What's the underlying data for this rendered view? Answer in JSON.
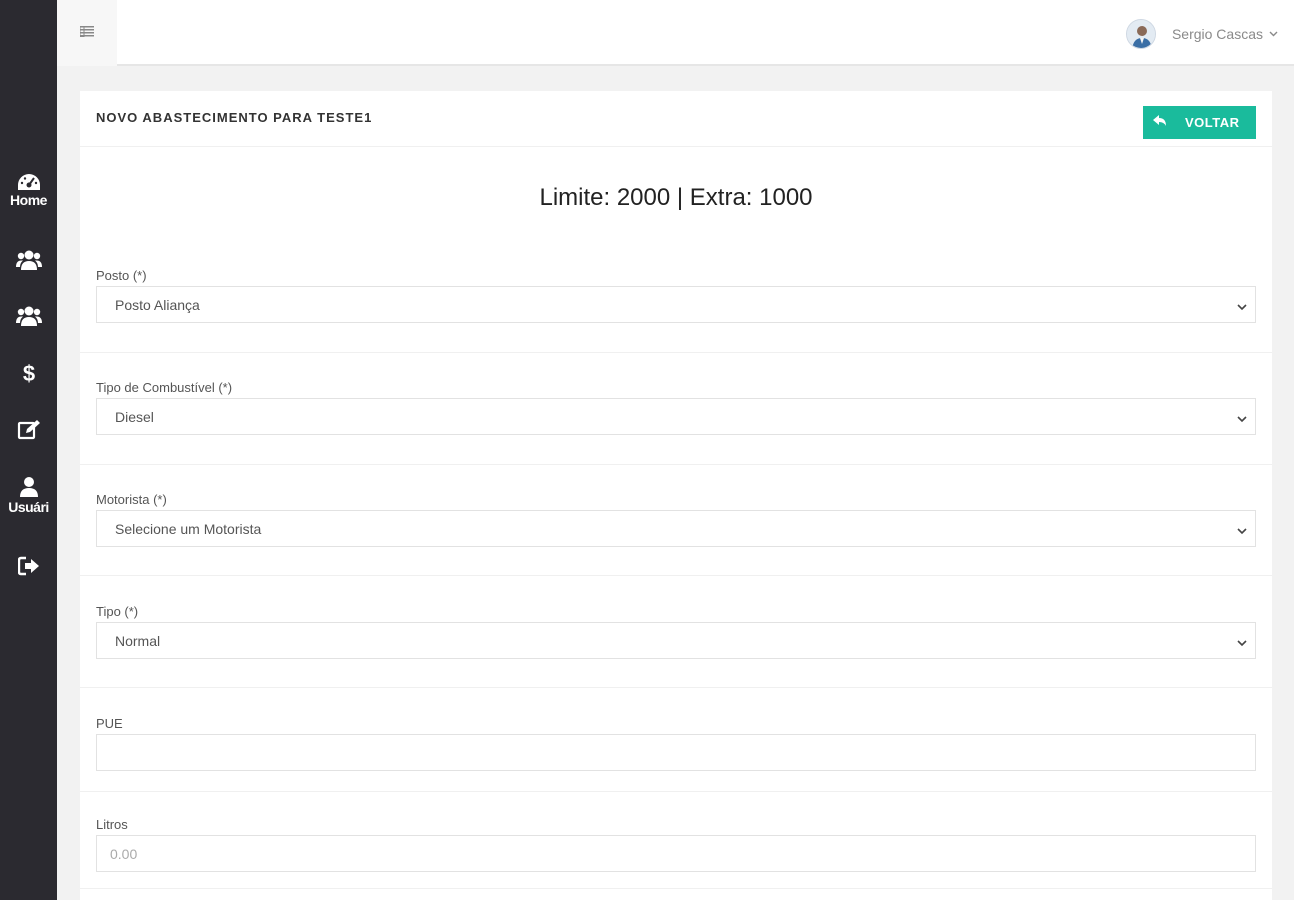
{
  "sidebar": {
    "items": [
      {
        "name": "sidebar-item-home",
        "icon": "dashboard-icon",
        "label": "Home"
      },
      {
        "name": "sidebar-item-group-1",
        "icon": "users-icon",
        "label": ""
      },
      {
        "name": "sidebar-item-group-2",
        "icon": "users-icon",
        "label": ""
      },
      {
        "name": "sidebar-item-financeiro",
        "icon": "dollar-icon",
        "label": ""
      },
      {
        "name": "sidebar-item-edit",
        "icon": "edit-icon",
        "label": ""
      },
      {
        "name": "sidebar-item-usuarios",
        "icon": "user-icon",
        "label": "Usuári"
      },
      {
        "name": "sidebar-item-logout",
        "icon": "sign-out-icon",
        "label": ""
      }
    ]
  },
  "header": {
    "menu_icon": "menu-icon",
    "user_name": "Sergio Cascas"
  },
  "card": {
    "title": "NOVO ABASTECIMENTO PARA TESTE1",
    "back_button": "VOLTAR",
    "limits_text": "Limite: 2000 | Extra: 1000"
  },
  "form": {
    "posto": {
      "label": "Posto (*)",
      "value": "Posto Aliança"
    },
    "combustivel": {
      "label": "Tipo de Combustível (*)",
      "value": "Diesel"
    },
    "motorista": {
      "label": "Motorista (*)",
      "value": "Selecione um Motorista"
    },
    "tipo": {
      "label": "Tipo (*)",
      "value": "Normal"
    },
    "pue": {
      "label": "PUE",
      "value": ""
    },
    "litros": {
      "label": "Litros",
      "placeholder": "0.00"
    }
  },
  "colors": {
    "sidebar_bg": "#2b2a30",
    "accent": "#1abb9c",
    "page_bg": "#f2f2f2"
  }
}
